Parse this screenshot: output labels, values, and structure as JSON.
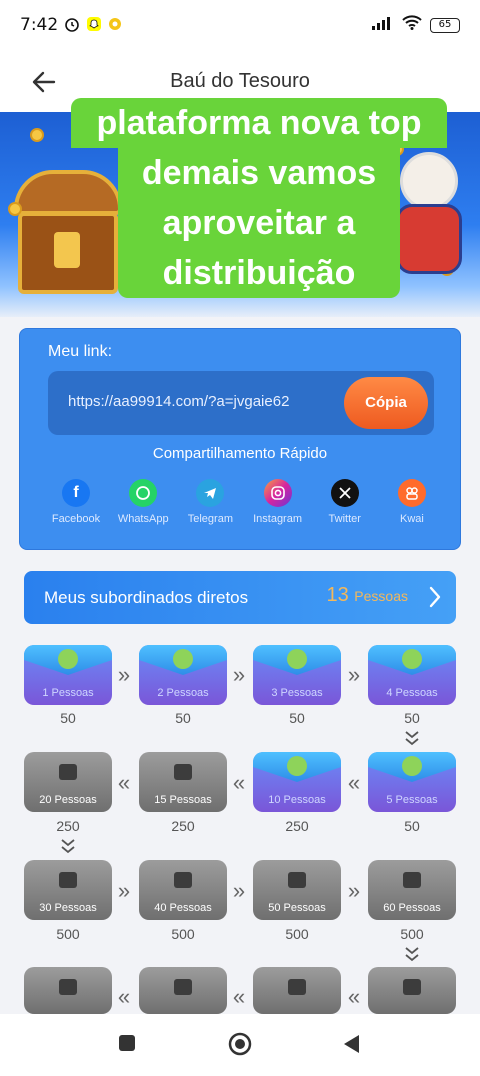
{
  "status": {
    "time": "7:42",
    "battery": "65"
  },
  "header": {
    "title": "Baú do Tesouro"
  },
  "overlay": {
    "lines": [
      "plataforma nova top",
      "demais vamos",
      "aproveitar a",
      "distribuição"
    ]
  },
  "link_card": {
    "label": "Meu link:",
    "url": "https://aa99914.com/?a=jvgaie62",
    "copy_label": "Cópia",
    "share_title": "Compartilhamento Rápido",
    "share": [
      {
        "label": "Facebook",
        "color": "#1877f2",
        "icon": "facebook-icon"
      },
      {
        "label": "WhatsApp",
        "color": "#25d366",
        "icon": "whatsapp-icon"
      },
      {
        "label": "Telegram",
        "color": "#2aa3e0",
        "icon": "telegram-icon"
      },
      {
        "label": "Instagram",
        "color": "#d6249f",
        "icon": "instagram-icon"
      },
      {
        "label": "Twitter",
        "color": "#111111",
        "icon": "x-icon"
      },
      {
        "label": "Kwai",
        "color": "#ff6b2c",
        "icon": "kwai-icon"
      }
    ]
  },
  "subordinates": {
    "label": "Meus subordinados diretos",
    "count": "13",
    "unit": "Pessoas"
  },
  "rewards": {
    "row1": [
      {
        "label": "1 Pessoas",
        "amount": "50"
      },
      {
        "label": "2 Pessoas",
        "amount": "50"
      },
      {
        "label": "3 Pessoas",
        "amount": "50"
      },
      {
        "label": "4 Pessoas",
        "amount": "50"
      }
    ],
    "row2": [
      {
        "label": "20 Pessoas",
        "amount": "250"
      },
      {
        "label": "15 Pessoas",
        "amount": "250"
      },
      {
        "label": "10 Pessoas",
        "amount": "250"
      },
      {
        "label": "5 Pessoas",
        "amount": "50"
      }
    ],
    "row3": [
      {
        "label": "30 Pessoas",
        "amount": "500"
      },
      {
        "label": "40 Pessoas",
        "amount": "500"
      },
      {
        "label": "50 Pessoas",
        "amount": "500"
      },
      {
        "label": "60 Pessoas",
        "amount": "500"
      }
    ]
  },
  "symbols": {
    "right": "»",
    "left": "«"
  }
}
